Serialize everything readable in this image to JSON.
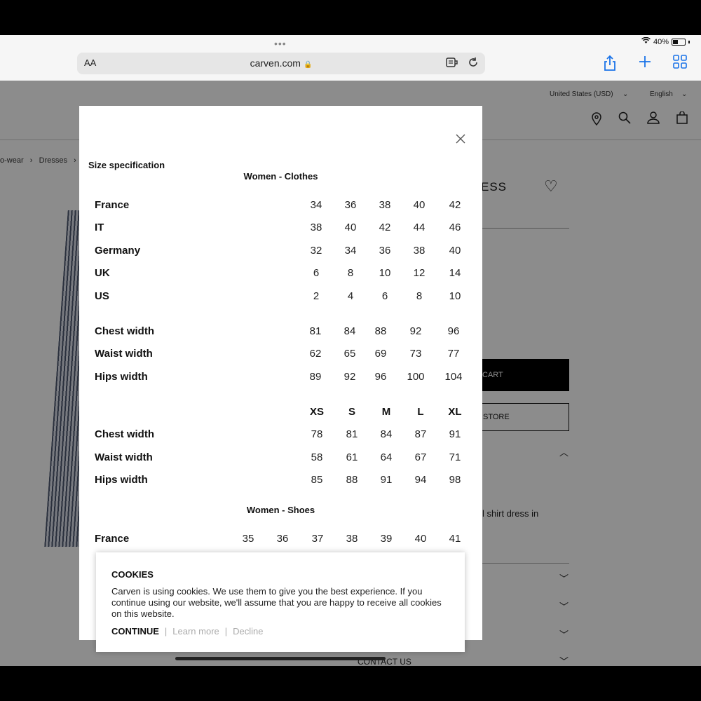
{
  "status": {
    "battery": "40%",
    "dots": "•••"
  },
  "browser": {
    "aa_label": "AA",
    "url": "carven.com",
    "lock": "🔒",
    "reader_icon": "reader-icon",
    "reload_icon": "reload-icon",
    "share_icon": "share-icon",
    "plus_icon": "plus-icon",
    "tabs_icon": "tabs-icon"
  },
  "header": {
    "region": "United States (USD)",
    "language": "English"
  },
  "breadcrumb": {
    "item1": "o-wear",
    "item2": "Dresses"
  },
  "product": {
    "title_fragment": "ESS",
    "cart_fragment": "CART",
    "store_fragment": "STORE",
    "desc_fragment": "l shirt dress in",
    "contact": "CONTACT US"
  },
  "modal": {
    "title": "Size specification",
    "clothes_section": "Women - Clothes",
    "clothes_conversion": [
      {
        "label": "France",
        "values": [
          "34",
          "36",
          "38",
          "40",
          "42"
        ]
      },
      {
        "label": "IT",
        "values": [
          "38",
          "40",
          "42",
          "44",
          "46"
        ]
      },
      {
        "label": "Germany",
        "values": [
          "32",
          "34",
          "36",
          "38",
          "40"
        ]
      },
      {
        "label": "UK",
        "values": [
          "6",
          "8",
          "10",
          "12",
          "14"
        ]
      },
      {
        "label": "US",
        "values": [
          "2",
          "4",
          "6",
          "8",
          "10"
        ]
      }
    ],
    "measurements_numeric": [
      {
        "label": "Chest width",
        "values": [
          "81",
          "84",
          "88",
          "92",
          "96"
        ]
      },
      {
        "label": "Waist width",
        "values": [
          "62",
          "65",
          "69",
          "73",
          "77"
        ]
      },
      {
        "label": "Hips width",
        "values": [
          "89",
          "92",
          "96",
          "100",
          "104"
        ]
      }
    ],
    "letter_sizes": [
      "XS",
      "S",
      "M",
      "L",
      "XL"
    ],
    "measurements_letter": [
      {
        "label": "Chest width",
        "values": [
          "78",
          "81",
          "84",
          "87",
          "91"
        ]
      },
      {
        "label": "Waist width",
        "values": [
          "58",
          "61",
          "64",
          "67",
          "71"
        ]
      },
      {
        "label": "Hips width",
        "values": [
          "85",
          "88",
          "91",
          "94",
          "98"
        ]
      }
    ],
    "shoes_section": "Women - Shoes",
    "shoes_conversion": [
      {
        "label": "France",
        "values": [
          "35",
          "36",
          "37",
          "38",
          "39",
          "40",
          "41"
        ]
      }
    ]
  },
  "cookies": {
    "title": "COOKIES",
    "text": "Carven is using cookies. We use them to give you the best experience. If you continue using our website, we'll assume that you are happy to receive all cookies on this website.",
    "continue": "CONTINUE",
    "learn_more": "Learn more",
    "decline": "Decline",
    "separator": "|"
  }
}
